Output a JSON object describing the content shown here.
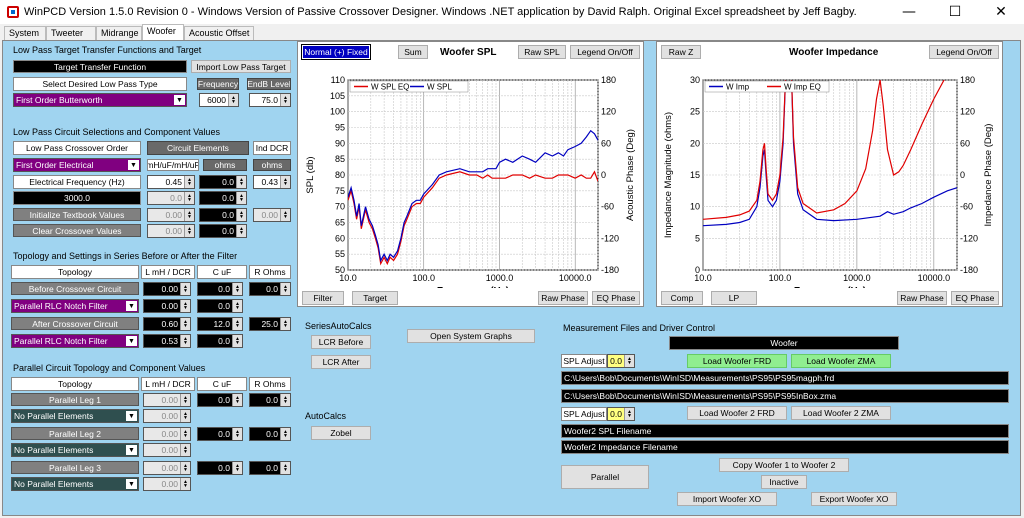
{
  "window": {
    "title": "WinPCD Version 1.5.0 Revision 0 - Windows Version of Passive Crossover Designer. Windows .NET application by David Ralph. Original Excel spreadsheet by Jeff Bagby."
  },
  "tabs": [
    "System",
    "Tweeter",
    "Midrange",
    "Woofer",
    "Acoustic Offset"
  ],
  "lowpass": {
    "group": "Low Pass Target Transfer Functions and Target",
    "ttf": "Target Transfer Function",
    "import_btn": "Import Low Pass Target",
    "select_label": "Select Desired Low Pass Type",
    "freq_btn": "Frequency",
    "endb_btn": "EndB Level",
    "type": "First Order Butterworth",
    "freq": "6000",
    "level": "75.0"
  },
  "circuit": {
    "group": "Low Pass Circuit Selections and Component Values",
    "order_label": "Low Pass Crossover Order",
    "elements_btn": "Circuit Elements",
    "ind_dcr": "Ind DCR",
    "order": "First Order Electrical",
    "units": "mH/uF/mH/uF",
    "ohms1": "ohms",
    "ohms2": "ohms",
    "elec_freq_label": "Electrical Frequency (Hz)",
    "freq_value": "3000.0",
    "v1": "0.45",
    "v2": "0.0",
    "v3": "0.43",
    "r2a": "0.0",
    "r2b": "0.0",
    "init_btn": "Initialize Textbook Values",
    "r3a": "0.00",
    "r3b": "0.0",
    "r3c": "0.00",
    "clear_btn": "Clear Crossover Values",
    "r4a": "0.00",
    "r4b": "0.0"
  },
  "topology": {
    "group": "Topology and Settings in Series Before or After the Filter",
    "headers": [
      "Topology",
      "L mH / DCR",
      "C uF",
      "R Ohms"
    ],
    "before": "Before Crossover Circuit",
    "before_vals": [
      "0.00",
      "0.0",
      "0.0"
    ],
    "notch1": "Parallel RLC Notch Filter",
    "notch1_vals": [
      "0.00",
      "0.0"
    ],
    "after": "After Crossover Circuit",
    "after_vals": [
      "0.60",
      "12.0",
      "25.0"
    ],
    "notch2": "Parallel RLC Notch Filter",
    "notch2_vals": [
      "0.53",
      "0.0"
    ]
  },
  "parallel": {
    "group": "Parallel Circuit Topology and Component Values",
    "headers": [
      "Topology",
      "L mH / DCR",
      "C uF",
      "R Ohms"
    ],
    "leg1": "Parallel Leg 1",
    "leg2": "Parallel Leg 2",
    "leg3": "Parallel Leg 3",
    "none": "No Parallel Elements",
    "zero2": "0.00",
    "zero1": "0.0"
  },
  "spl": {
    "mode_btn": "Normal (+) Fixed",
    "sum_btn": "Sum",
    "title": "Woofer SPL",
    "raw_btn": "Raw SPL",
    "legend_btn": "Legend On/Off",
    "legend": [
      "W SPL EQ",
      "W SPL"
    ],
    "ylabel": "SPL (db)",
    "y2label": "Acoustic Phase (Deg)",
    "xlabel": "Frequency (Hz)",
    "filter_btn": "Filter",
    "target_btn": "Target",
    "rawphase_btn": "Raw Phase",
    "eqphase_btn": "EQ Phase"
  },
  "imp": {
    "rawz_btn": "Raw Z",
    "title": "Woofer Impedance",
    "legend_btn": "Legend On/Off",
    "legend": [
      "W Imp",
      "W Imp EQ"
    ],
    "ylabel": "Impedance Magnitude (ohms)",
    "y2label": "Impedance Phase (Deg)",
    "xlabel": "Frequency (Hz)",
    "comp_btn": "Comp",
    "lp_btn": "LP",
    "rawphase_btn": "Raw Phase",
    "eqphase_btn": "EQ Phase"
  },
  "series_calcs": {
    "group": "SeriesAutoCalcs",
    "before": "LCR Before",
    "after": "LCR After"
  },
  "auto_calcs": {
    "group": "AutoCalcs",
    "zobel": "Zobel"
  },
  "open_graphs": "Open System Graphs",
  "measure": {
    "group": "Measurement Files and Driver Control",
    "driver": "Woofer",
    "spl_adjust": "SPL Adjust",
    "adj1": "0.0",
    "load_frd": "Load Woofer FRD",
    "load_zma": "Load Woofer ZMA",
    "frd_path": "C:\\Users\\Bob\\Documents\\WinISD\\Measurements\\PS95\\PS95magph.frd",
    "zma_path": "C:\\Users\\Bob\\Documents\\WinISD\\Measurements\\PS95\\PS95InBox.zma",
    "adj2": "0.0",
    "load_frd2": "Load Woofer 2 FRD",
    "load_zma2": "Load Woofer 2  ZMA",
    "w2_spl": "Woofer2 SPL Filename",
    "w2_imp": "Woofer2 Impedance Filename",
    "copy_btn": "Copy Woofer 1 to  Woofer 2",
    "parallel_btn": "Parallel",
    "inactive_btn": "Inactive",
    "import_btn": "Import Woofer XO",
    "export_btn": "Export Woofer XO"
  },
  "colors": {
    "eq": "#e00000",
    "raw": "#0000c0",
    "bg": "#a0d4f0"
  },
  "chart_data": [
    {
      "type": "line",
      "title": "Woofer SPL",
      "xlabel": "Frequency (Hz)",
      "ylabel": "SPL (db)",
      "y2label": "Acoustic Phase (Deg)",
      "xscale": "log",
      "xlim": [
        10,
        20000
      ],
      "ylim": [
        50,
        110
      ],
      "y2lim": [
        -180,
        180
      ],
      "xticks": [
        "10.0",
        "100.0",
        "1000.0",
        "10000.0"
      ],
      "yticks": [
        "50",
        "55",
        "60",
        "65",
        "70",
        "75",
        "80",
        "85",
        "90",
        "95",
        "100",
        "105",
        "110"
      ],
      "y2ticks": [
        "-180",
        "-120",
        "-60",
        "0",
        "60",
        "120",
        "180"
      ],
      "grid": true,
      "legend_position": "top-left",
      "series": [
        {
          "name": "W SPL EQ",
          "color": "#e00000",
          "x": [
            10,
            11,
            12,
            13,
            14,
            15,
            17,
            19,
            21,
            23,
            25,
            27,
            30,
            33,
            36,
            40,
            45,
            50,
            55,
            60,
            70,
            80,
            90,
            100,
            130,
            160,
            200,
            300,
            400,
            500,
            600,
            700,
            800,
            900,
            1000,
            1200,
            1500,
            2000,
            2500,
            3000,
            4000,
            5000,
            6000,
            7000,
            8000,
            10000,
            12000,
            14000,
            16000,
            18000,
            20000
          ],
          "y": [
            72,
            75,
            71,
            66,
            70,
            63,
            69,
            65,
            63,
            60,
            57,
            52,
            54,
            52,
            54,
            53,
            55,
            59,
            64,
            66,
            70,
            71,
            71,
            73,
            76,
            79,
            80,
            81,
            80,
            80,
            79,
            80,
            79,
            79,
            79,
            79,
            80,
            80,
            79,
            80,
            79,
            79,
            80,
            80,
            80,
            79,
            80,
            79,
            79,
            81,
            78
          ]
        },
        {
          "name": "W SPL",
          "color": "#0000c0",
          "x": [
            10,
            11,
            12,
            13,
            14,
            15,
            17,
            19,
            21,
            23,
            25,
            27,
            30,
            33,
            36,
            40,
            45,
            50,
            55,
            60,
            70,
            80,
            90,
            100,
            130,
            160,
            200,
            300,
            400,
            500,
            600,
            700,
            800,
            900,
            1000,
            1200,
            1500,
            2000,
            2500,
            3000,
            4000,
            5000,
            6000,
            7000,
            8000,
            10000,
            12000,
            14000,
            16000,
            18000,
            20000
          ],
          "y": [
            73,
            76,
            72,
            67,
            71,
            64,
            70,
            66,
            64,
            61,
            58,
            53,
            55,
            53,
            55,
            54,
            56,
            60,
            65,
            67,
            71,
            72,
            72,
            74,
            77,
            80,
            81,
            82,
            81,
            81,
            81,
            82,
            82,
            82,
            84,
            85,
            84,
            86,
            85,
            84,
            87,
            86,
            87,
            86,
            88,
            89,
            90,
            92,
            94,
            93,
            91
          ]
        }
      ]
    },
    {
      "type": "line",
      "title": "Woofer Impedance",
      "xlabel": "Frequency (Hz)",
      "ylabel": "Impedance Magnitude (ohms)",
      "y2label": "Impedance Phase (Deg)",
      "xscale": "log",
      "xlim": [
        10,
        20000
      ],
      "ylim": [
        0,
        30
      ],
      "y2lim": [
        -180,
        180
      ],
      "xticks": [
        "10.0",
        "100.0",
        "1000.0",
        "10000.0"
      ],
      "yticks": [
        "0",
        "5",
        "10",
        "15",
        "20",
        "25",
        "30"
      ],
      "y2ticks": [
        "-180",
        "-120",
        "-60",
        "0",
        "60",
        "120",
        "180"
      ],
      "grid": true,
      "legend_position": "top",
      "series": [
        {
          "name": "W Imp",
          "color": "#0000c0",
          "x": [
            10,
            20,
            30,
            40,
            50,
            55,
            60,
            63,
            66,
            70,
            80,
            90,
            100,
            110,
            120,
            130,
            140,
            150,
            170,
            200,
            300,
            500,
            1000,
            2000,
            2500,
            3000,
            4000,
            5000,
            7000,
            10000,
            15000,
            20000
          ],
          "y": [
            7,
            7.2,
            7.5,
            8,
            10,
            13,
            18,
            19,
            15,
            11,
            10,
            11,
            14,
            20,
            32,
            40,
            32,
            20,
            12,
            9.5,
            8,
            7.8,
            8,
            8.5,
            9.2,
            8.8,
            9.2,
            9.8,
            10.5,
            11.5,
            12.5,
            13
          ]
        },
        {
          "name": "W Imp EQ",
          "color": "#e00000",
          "x": [
            10,
            20,
            30,
            40,
            50,
            55,
            60,
            63,
            66,
            70,
            80,
            90,
            100,
            110,
            120,
            130,
            140,
            150,
            170,
            200,
            300,
            500,
            700,
            1000,
            1300,
            1600,
            1800,
            2000,
            2200,
            2500,
            3000,
            3500,
            4000,
            5000,
            7000,
            10000,
            15000,
            20000
          ],
          "y": [
            8,
            8.3,
            8.7,
            9.3,
            11,
            14,
            19,
            20,
            16,
            12,
            11,
            12,
            15,
            21,
            32,
            40,
            32,
            21,
            13,
            10.5,
            9,
            9.5,
            10.5,
            12.5,
            16,
            22,
            27,
            30,
            26,
            19,
            15,
            15.5,
            16.5,
            19,
            23,
            27,
            31,
            34
          ]
        }
      ]
    }
  ]
}
